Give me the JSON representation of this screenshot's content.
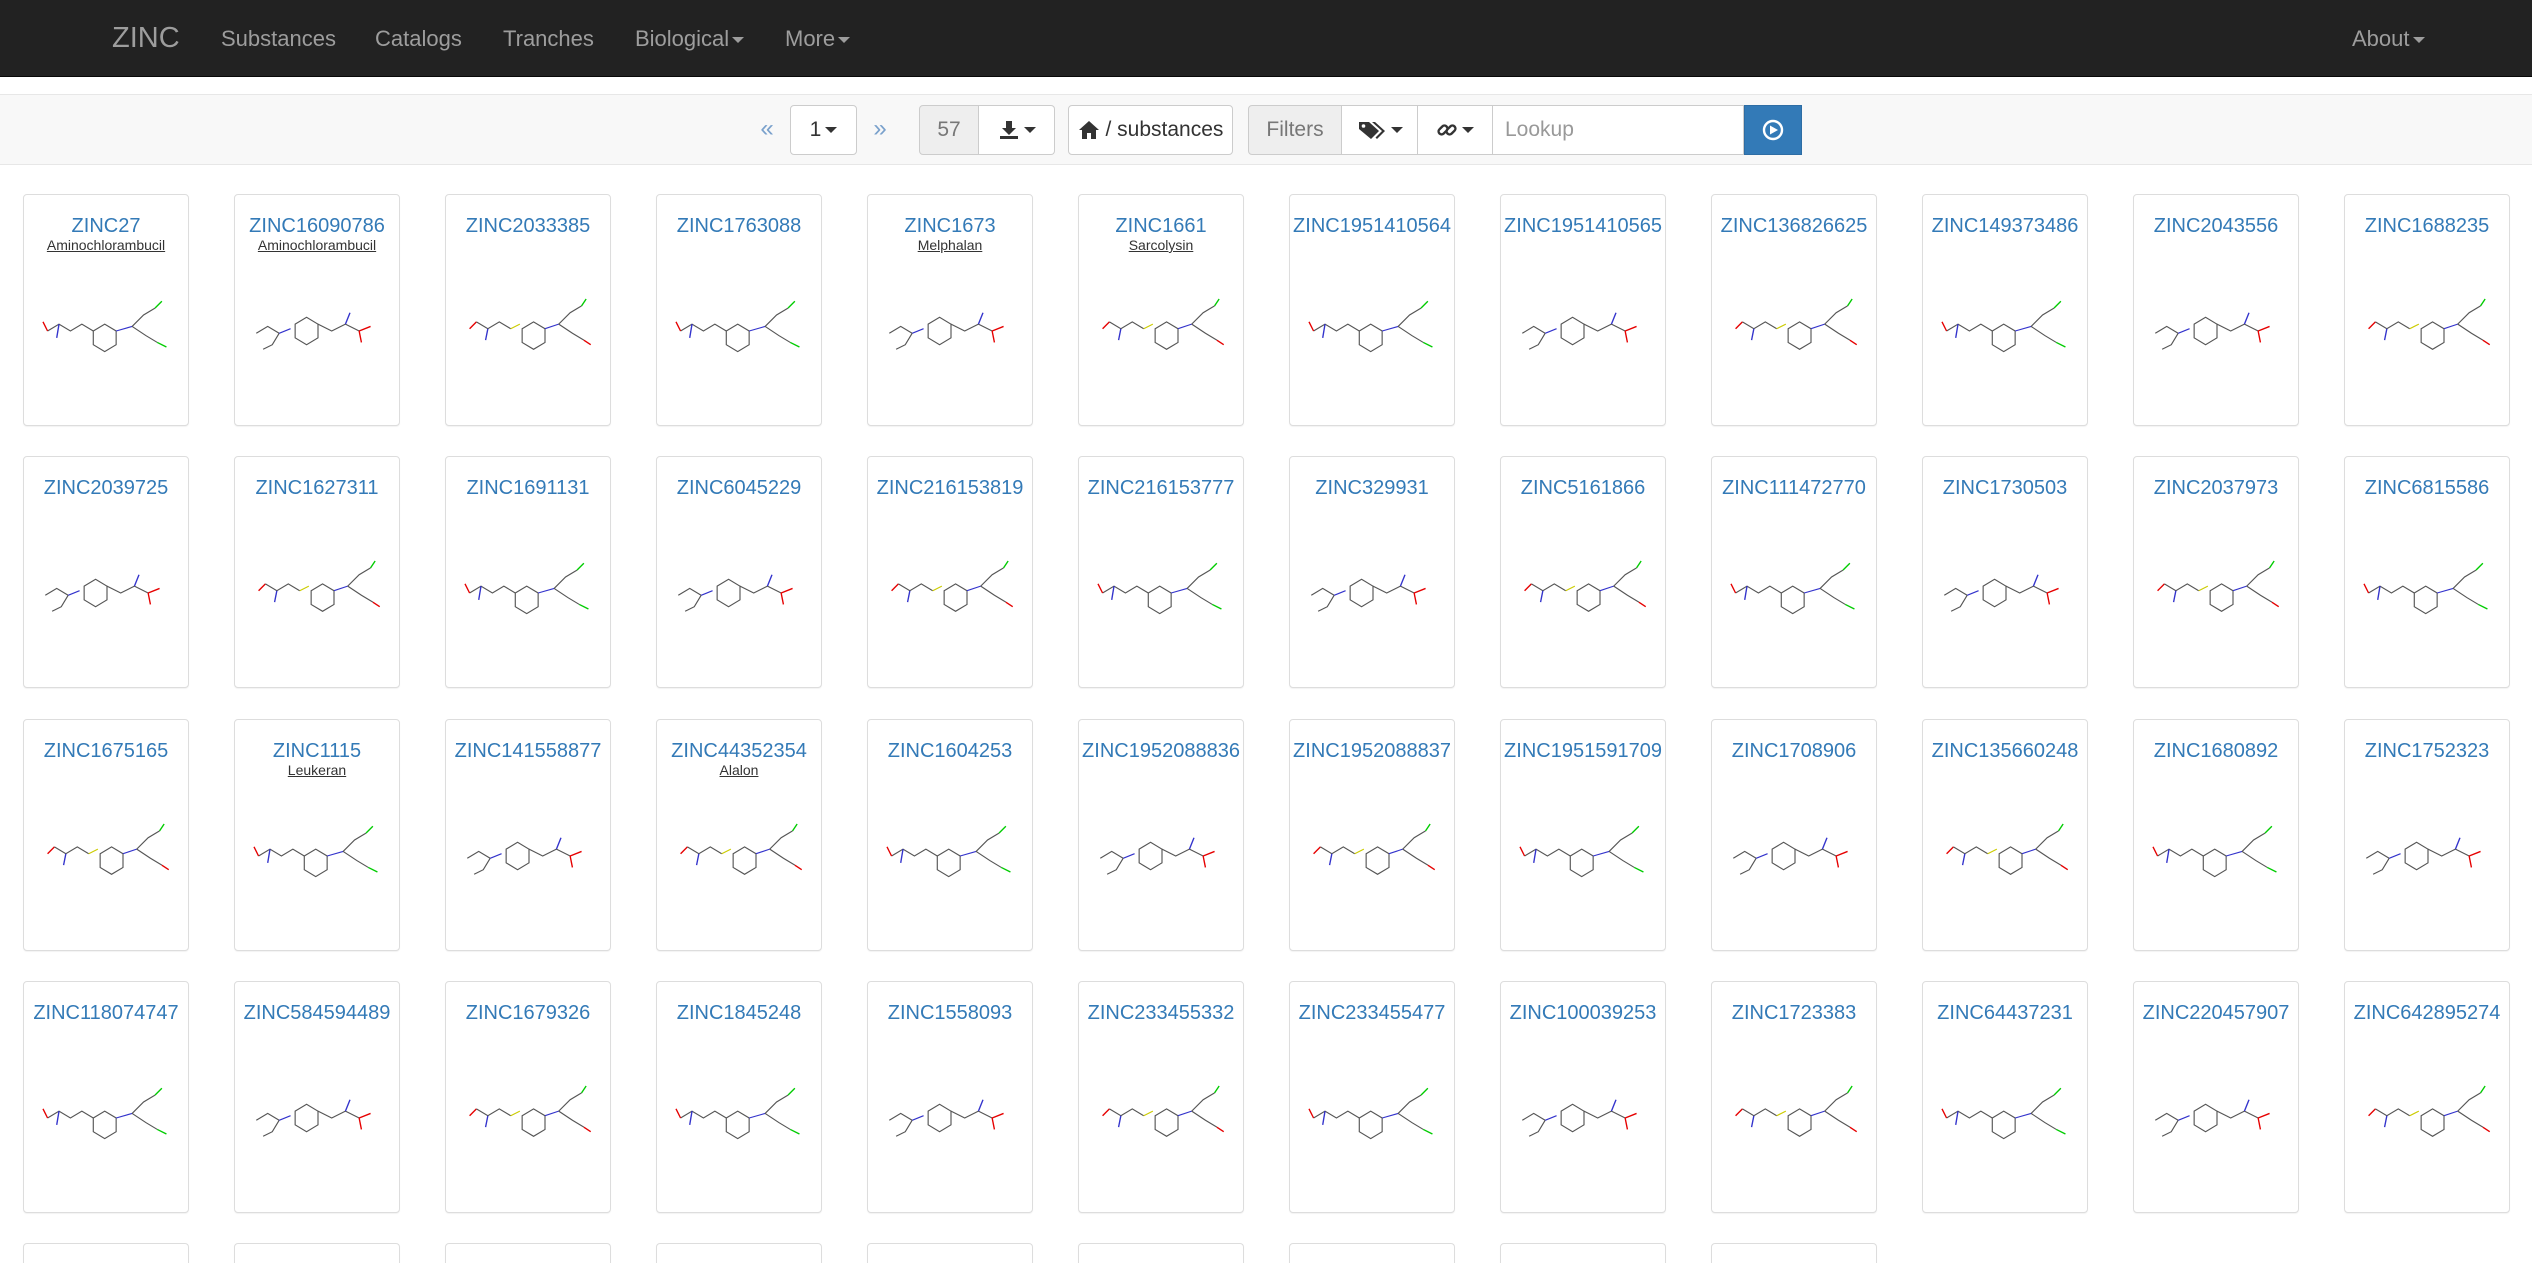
{
  "navbar": {
    "brand": "ZINC",
    "items": [
      {
        "label": "Substances",
        "dropdown": false
      },
      {
        "label": "Catalogs",
        "dropdown": false
      },
      {
        "label": "Tranches",
        "dropdown": false
      },
      {
        "label": "Biological",
        "dropdown": true
      },
      {
        "label": "More",
        "dropdown": true
      }
    ],
    "about": "About"
  },
  "toolbar": {
    "prev": "«",
    "page": "1",
    "next": "»",
    "page_count": "57",
    "path": "/ substances",
    "filters": "Filters",
    "lookup_placeholder": "Lookup"
  },
  "colors": {
    "navbar_bg": "#222222",
    "link": "#337ab7",
    "go_button": "#337ab7"
  },
  "substances": [
    {
      "id": "ZINC27",
      "name": "Aminochlorambucil"
    },
    {
      "id": "ZINC16090786",
      "name": "Aminochlorambucil"
    },
    {
      "id": "ZINC2033385",
      "name": ""
    },
    {
      "id": "ZINC1763088",
      "name": ""
    },
    {
      "id": "ZINC1673",
      "name": "Melphalan"
    },
    {
      "id": "ZINC1661",
      "name": "Sarcolysin"
    },
    {
      "id": "ZINC1951410564",
      "name": ""
    },
    {
      "id": "ZINC1951410565",
      "name": ""
    },
    {
      "id": "ZINC136826625",
      "name": ""
    },
    {
      "id": "ZINC149373486",
      "name": ""
    },
    {
      "id": "ZINC2043556",
      "name": ""
    },
    {
      "id": "ZINC1688235",
      "name": ""
    },
    {
      "id": "ZINC2039725",
      "name": ""
    },
    {
      "id": "ZINC1627311",
      "name": ""
    },
    {
      "id": "ZINC1691131",
      "name": ""
    },
    {
      "id": "ZINC6045229",
      "name": ""
    },
    {
      "id": "ZINC216153819",
      "name": ""
    },
    {
      "id": "ZINC216153777",
      "name": ""
    },
    {
      "id": "ZINC329931",
      "name": ""
    },
    {
      "id": "ZINC5161866",
      "name": ""
    },
    {
      "id": "ZINC111472770",
      "name": ""
    },
    {
      "id": "ZINC1730503",
      "name": ""
    },
    {
      "id": "ZINC2037973",
      "name": ""
    },
    {
      "id": "ZINC6815586",
      "name": ""
    },
    {
      "id": "ZINC1675165",
      "name": ""
    },
    {
      "id": "ZINC1115",
      "name": "Leukeran"
    },
    {
      "id": "ZINC141558877",
      "name": ""
    },
    {
      "id": "ZINC44352354",
      "name": "Alalon"
    },
    {
      "id": "ZINC1604253",
      "name": ""
    },
    {
      "id": "ZINC1952088836",
      "name": ""
    },
    {
      "id": "ZINC1952088837",
      "name": ""
    },
    {
      "id": "ZINC1951591709",
      "name": ""
    },
    {
      "id": "ZINC1708906",
      "name": ""
    },
    {
      "id": "ZINC135660248",
      "name": ""
    },
    {
      "id": "ZINC1680892",
      "name": ""
    },
    {
      "id": "ZINC1752323",
      "name": ""
    },
    {
      "id": "ZINC118074747",
      "name": ""
    },
    {
      "id": "ZINC584594489",
      "name": ""
    },
    {
      "id": "ZINC1679326",
      "name": ""
    },
    {
      "id": "ZINC1845248",
      "name": ""
    },
    {
      "id": "ZINC1558093",
      "name": ""
    },
    {
      "id": "ZINC233455332",
      "name": ""
    },
    {
      "id": "ZINC233455477",
      "name": ""
    },
    {
      "id": "ZINC100039253",
      "name": ""
    },
    {
      "id": "ZINC1723383",
      "name": ""
    },
    {
      "id": "ZINC64437231",
      "name": ""
    },
    {
      "id": "ZINC220457907",
      "name": ""
    },
    {
      "id": "ZINC642895274",
      "name": ""
    }
  ]
}
